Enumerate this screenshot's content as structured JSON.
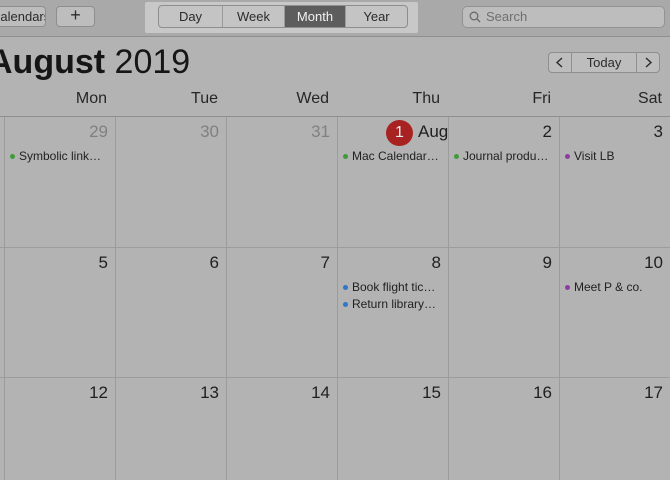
{
  "toolbar": {
    "calendars_label": "Calendars",
    "add_label": "+",
    "views": [
      {
        "label": "Day",
        "active": false
      },
      {
        "label": "Week",
        "active": false
      },
      {
        "label": "Month",
        "active": true
      },
      {
        "label": "Year",
        "active": false
      }
    ],
    "search_placeholder": "Search"
  },
  "header": {
    "month": "August",
    "year": "2019",
    "today_label": "Today",
    "prev_icon": "chevron-left-icon",
    "next_icon": "chevron-right-icon"
  },
  "weekdays": [
    "Mon",
    "Tue",
    "Wed",
    "Thu",
    "Fri",
    "Sat"
  ],
  "today": {
    "day": "1",
    "month_label": "Aug"
  },
  "weeks": [
    {
      "days": [
        {
          "num": "29",
          "other": true,
          "events": [
            {
              "title": "Symbolic link…",
              "color": "#3f9b3a"
            }
          ]
        },
        {
          "num": "30",
          "other": true,
          "events": []
        },
        {
          "num": "31",
          "other": true,
          "events": []
        },
        {
          "num": "1",
          "today": true,
          "events": [
            {
              "title": "Mac Calendar…",
              "color": "#3f9b3a"
            }
          ]
        },
        {
          "num": "2",
          "events": [
            {
              "title": "Journal produ…",
              "color": "#3f9b3a"
            }
          ]
        },
        {
          "num": "3",
          "events": [
            {
              "title": "Visit LB",
              "color": "#8e3ba2"
            }
          ]
        }
      ]
    },
    {
      "days": [
        {
          "num": "5",
          "events": []
        },
        {
          "num": "6",
          "events": []
        },
        {
          "num": "7",
          "events": []
        },
        {
          "num": "8",
          "events": [
            {
              "title": "Book flight tic…",
              "color": "#2f78c4"
            },
            {
              "title": "Return library…",
              "color": "#2f78c4"
            }
          ]
        },
        {
          "num": "9",
          "events": []
        },
        {
          "num": "10",
          "events": [
            {
              "title": "Meet P & co.",
              "color": "#8e3ba2"
            }
          ]
        }
      ]
    },
    {
      "days": [
        {
          "num": "12",
          "events": []
        },
        {
          "num": "13",
          "events": []
        },
        {
          "num": "14",
          "events": []
        },
        {
          "num": "15",
          "events": []
        },
        {
          "num": "16",
          "events": []
        },
        {
          "num": "17",
          "events": []
        }
      ]
    }
  ]
}
